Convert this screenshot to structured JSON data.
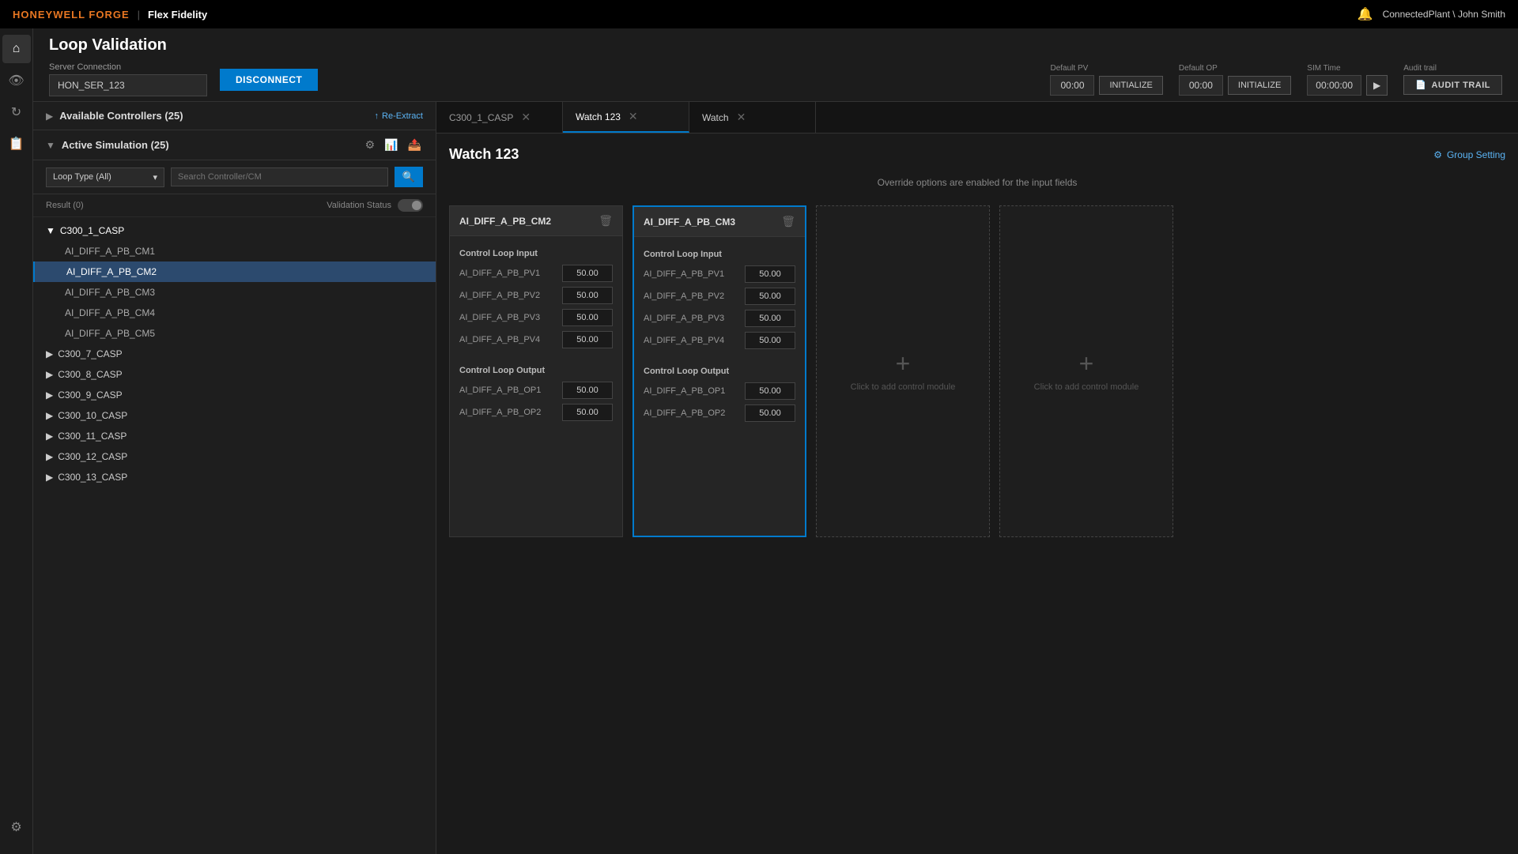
{
  "topbar": {
    "brand": "HONEYWELL FORGE",
    "divider": "|",
    "product": "Flex Fidelity",
    "user": "ConnectedPlant \\ John Smith"
  },
  "page": {
    "title": "Loop Validation"
  },
  "server": {
    "label": "Server Connection",
    "value": "HON_SER_123",
    "disconnect_label": "DISCONNECT"
  },
  "header_controls": {
    "default_pv_label": "Default PV",
    "default_pv_value": "00:00",
    "default_op_label": "Default OP",
    "default_op_value": "00:00",
    "sim_time_label": "SIM Time",
    "sim_time_value": "00:00:00",
    "audit_label": "Audit trail",
    "audit_btn": "AUDIT TRAIL",
    "initialize1": "INITIALIZE",
    "initialize2": "INITIALIZE"
  },
  "left_panel": {
    "available_label": "Available Controllers (25)",
    "re_extract": "Re-Extract",
    "active_sim_label": "Active Simulation (25)",
    "loop_type_placeholder": "Loop Type (All)",
    "search_placeholder": "Search Controller/CM",
    "result_label": "Result (0)",
    "validation_status": "Validation Status",
    "tree": [
      {
        "id": "C300_1_CASP",
        "label": "C300_1_CASP",
        "expanded": true,
        "children": [
          {
            "id": "AI_DIFF_A_PB_CM1",
            "label": "AI_DIFF_A_PB_CM1",
            "active": false
          },
          {
            "id": "AI_DIFF_A_PB_CM2",
            "label": "AI_DIFF_A_PB_CM2",
            "active": true
          },
          {
            "id": "AI_DIFF_A_PB_CM3",
            "label": "AI_DIFF_A_PB_CM3",
            "active": false
          },
          {
            "id": "AI_DIFF_A_PB_CM4",
            "label": "AI_DIFF_A_PB_CM4",
            "active": false
          },
          {
            "id": "AI_DIFF_A_PB_CM5",
            "label": "AI_DIFF_A_PB_CM5",
            "active": false
          }
        ]
      },
      {
        "id": "C300_7_CASP",
        "label": "C300_7_CASP",
        "expanded": false
      },
      {
        "id": "C300_8_CASP",
        "label": "C300_8_CASP",
        "expanded": false
      },
      {
        "id": "C300_9_CASP",
        "label": "C300_9_CASP",
        "expanded": false
      },
      {
        "id": "C300_10_CASP",
        "label": "C300_10_CASP",
        "expanded": false
      },
      {
        "id": "C300_11_CASP",
        "label": "C300_11_CASP",
        "expanded": false
      },
      {
        "id": "C300_12_CASP",
        "label": "C300_12_CASP",
        "expanded": false
      },
      {
        "id": "C300_13_CASP",
        "label": "C300_13_CASP",
        "expanded": false
      }
    ]
  },
  "tabs": [
    {
      "id": "tab1",
      "label": "C300_1_CASP",
      "active": false,
      "closable": true
    },
    {
      "id": "tab2",
      "label": "Watch 123",
      "active": true,
      "closable": true
    },
    {
      "id": "tab3",
      "label": "Watch",
      "active": false,
      "closable": true,
      "is_add": true
    }
  ],
  "watch_panel": {
    "title": "Watch 123",
    "override_notice": "Override options are enabled for the input fields",
    "group_setting": "Group Setting",
    "modules": [
      {
        "id": "AI_DIFF_A_PB_CM2",
        "name": "AI_DIFF_A_PB_CM2",
        "active": false,
        "loop_input_label": "Control Loop Input",
        "inputs": [
          {
            "name": "AI_DIFF_A_PB_PV1",
            "value": "50.00"
          },
          {
            "name": "AI_DIFF_A_PB_PV2",
            "value": "50.00"
          },
          {
            "name": "AI_DIFF_A_PB_PV3",
            "value": "50.00"
          },
          {
            "name": "AI_DIFF_A_PB_PV4",
            "value": "50.00"
          }
        ],
        "loop_output_label": "Control Loop Output",
        "outputs": [
          {
            "name": "AI_DIFF_A_PB_OP1",
            "value": "50.00"
          },
          {
            "name": "AI_DIFF_A_PB_OP2",
            "value": "50.00"
          }
        ]
      },
      {
        "id": "AI_DIFF_A_PB_CM3",
        "name": "AI_DIFF_A_PB_CM3",
        "active": true,
        "loop_input_label": "Control Loop Input",
        "inputs": [
          {
            "name": "AI_DIFF_A_PB_PV1",
            "value": "50.00"
          },
          {
            "name": "AI_DIFF_A_PB_PV2",
            "value": "50.00"
          },
          {
            "name": "AI_DIFF_A_PB_PV3",
            "value": "50.00"
          },
          {
            "name": "AI_DIFF_A_PB_PV4",
            "value": "50.00"
          }
        ],
        "loop_output_label": "Control Loop Output",
        "outputs": [
          {
            "name": "AI_DIFF_A_PB_OP1",
            "value": "50.00"
          },
          {
            "name": "AI_DIFF_A_PB_OP2",
            "value": "50.00"
          }
        ]
      }
    ],
    "add_module_label": "Click to add control module"
  }
}
